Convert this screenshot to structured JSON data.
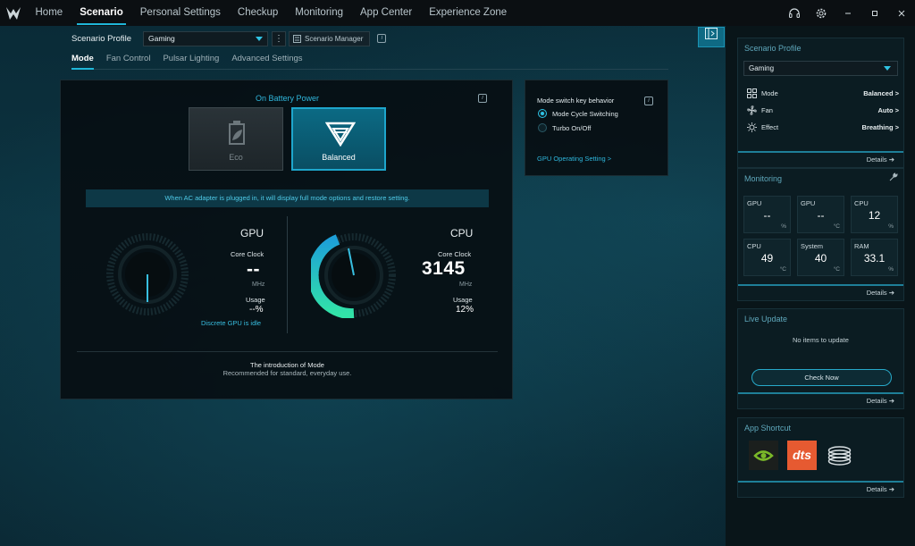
{
  "nav": {
    "items": [
      "Home",
      "Scenario",
      "Personal Settings",
      "Checkup",
      "Monitoring",
      "App Center",
      "Experience Zone"
    ],
    "active": "Scenario"
  },
  "profile": {
    "label": "Scenario Profile",
    "selected": "Gaming",
    "manager_label": "Scenario Manager"
  },
  "subtabs": [
    "Mode",
    "Fan Control",
    "Pulsar Lighting",
    "Advanced Settings"
  ],
  "mode_panel": {
    "battery_title": "On Battery Power",
    "modes": [
      {
        "label": "Eco",
        "active": false
      },
      {
        "label": "Balanced",
        "active": true
      }
    ],
    "ac_banner": "When AC adapter is plugged in, it will display full mode options and restore setting.",
    "gpu": {
      "title": "GPU",
      "clock_label": "Core Clock",
      "clock_value": "--",
      "clock_unit": "MHz",
      "usage_label": "Usage",
      "usage_value": "--%",
      "idle_text": "Discrete GPU is idle"
    },
    "cpu": {
      "title": "CPU",
      "clock_label": "Core Clock",
      "clock_value": "3145",
      "clock_unit": "MHz",
      "usage_label": "Usage",
      "usage_value": "12%",
      "usage_fraction": 0.12
    },
    "intro_title": "The introduction of Mode",
    "intro_desc": "Recommended for standard, everyday use."
  },
  "key_panel": {
    "title": "Mode switch key behavior",
    "options": [
      {
        "label": "Mode Cycle Switching",
        "selected": true
      },
      {
        "label": "Turbo On/Off",
        "selected": false
      }
    ],
    "link": "GPU Operating Setting >"
  },
  "sidebar": {
    "scenario_profile": {
      "title": "Scenario Profile",
      "selected": "Gaming",
      "rows": [
        {
          "label": "Mode",
          "value": "Balanced >",
          "icon": "grid-icon"
        },
        {
          "label": "Fan",
          "value": "Auto >",
          "icon": "fan-icon"
        },
        {
          "label": "Effect",
          "value": "Breathing >",
          "icon": "sun-icon"
        }
      ],
      "details": "Details"
    },
    "monitoring": {
      "title": "Monitoring",
      "tiles": [
        {
          "label": "GPU",
          "value": "--",
          "unit": "%"
        },
        {
          "label": "GPU",
          "value": "--",
          "unit": "°C"
        },
        {
          "label": "CPU",
          "value": "12",
          "unit": "%"
        },
        {
          "label": "CPU",
          "value": "49",
          "unit": "°C"
        },
        {
          "label": "System",
          "value": "40",
          "unit": "°C"
        },
        {
          "label": "RAM",
          "value": "33.1",
          "unit": "%"
        }
      ],
      "details": "Details"
    },
    "live_update": {
      "title": "Live Update",
      "status": "No items to update",
      "button": "Check Now",
      "details": "Details"
    },
    "app_shortcut": {
      "title": "App Shortcut",
      "apps": [
        "nvidia-icon",
        "dts-icon",
        "disc-stack-icon"
      ],
      "dts_text": "dts",
      "details": "Details"
    }
  },
  "colors": {
    "accent": "#1fb6d8",
    "nav_bg": "#0b0f12",
    "panel_bg": "#06100f"
  }
}
